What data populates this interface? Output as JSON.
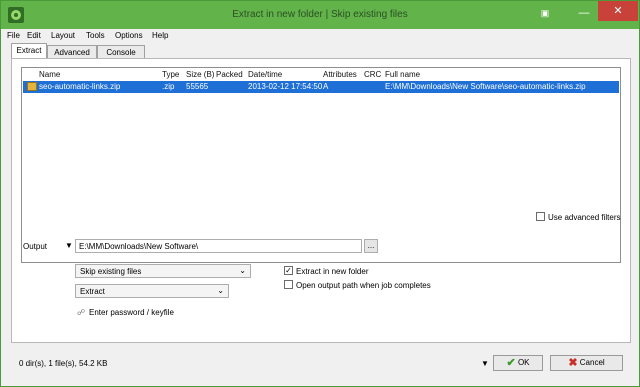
{
  "window": {
    "title": "Extract in new folder | Skip existing files",
    "title_color": "#62b34a"
  },
  "menu": [
    "File",
    "Edit",
    "Layout",
    "Tools",
    "Options",
    "Help"
  ],
  "tabs": [
    "Extract",
    "Advanced",
    "Console"
  ],
  "file_list": {
    "columns": [
      "Name",
      "Type",
      "Size (B)",
      "Packed",
      "Date/time",
      "Attributes",
      "CRC",
      "Full name"
    ],
    "rows": [
      {
        "name": "seo-automatic-links.zip",
        "type": ".zip",
        "size": "55565",
        "packed": "",
        "datetime": "2013-02-12 17:54:50",
        "attributes": "A",
        "crc": "",
        "fullname": "E:\\MM\\Downloads\\New Software\\seo-automatic-links.zip"
      }
    ],
    "selected_color": "#1e6fd6"
  },
  "advanced_filters_label": "Use advanced filters",
  "output": {
    "label": "Output",
    "path": "E:\\MM\\Downloads\\New Software\\",
    "browse_label": "...",
    "mode": "Skip existing files",
    "action": "Extract",
    "password_label": "Enter password / keyfile",
    "extract_new_folder_label": "Extract in new folder",
    "extract_new_folder_checked": true,
    "open_output_label": "Open output path when job completes",
    "open_output_checked": false
  },
  "status": {
    "text": "0 dir(s), 1 file(s), 54.2 KB"
  },
  "buttons": {
    "ok": "OK",
    "cancel": "Cancel"
  },
  "icons": {
    "app": "peazip-icon",
    "ok": "check-icon",
    "cancel": "x-icon",
    "password": "lock-icon"
  }
}
